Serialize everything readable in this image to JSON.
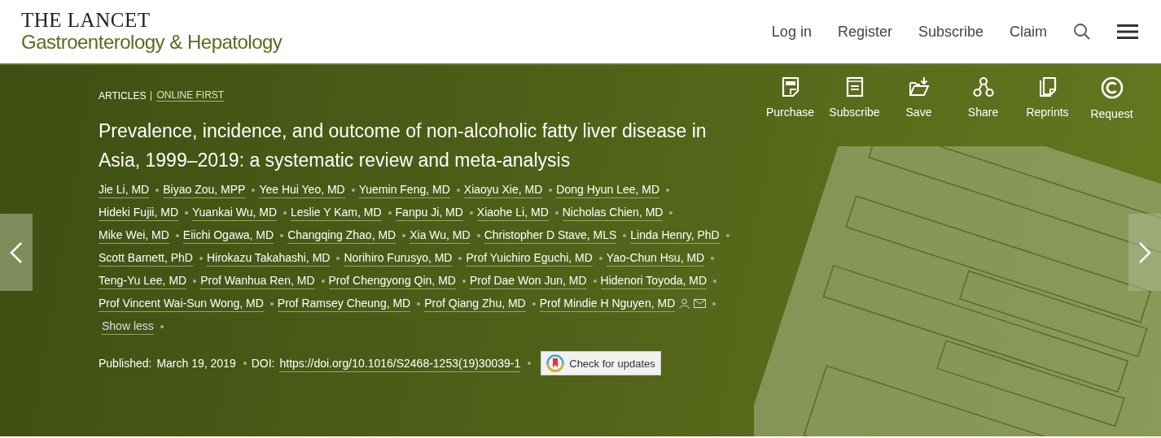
{
  "header": {
    "logo_top": "THE LANCET",
    "logo_bottom": "Gastroenterology & Hepatology",
    "nav": [
      "Log in",
      "Register",
      "Subscribe",
      "Claim"
    ]
  },
  "article": {
    "categories": [
      {
        "label": "ARTICLES",
        "link": false
      },
      {
        "label": "ONLINE FIRST",
        "link": true
      }
    ],
    "title": "Prevalence, incidence, and outcome of non-alcoholic fatty liver disease in Asia, 1999–2019: a systematic review and meta-analysis",
    "authors": [
      "Jie Li, MD",
      "Biyao Zou, MPP",
      "Yee Hui Yeo, MD",
      "Yuemin Feng, MD",
      "Xiaoyu Xie, MD",
      "Dong Hyun Lee, MD",
      "Hideki Fujii, MD",
      "Yuankai Wu, MD",
      "Leslie Y Kam, MD",
      "Fanpu Ji, MD",
      "Xiaohe Li, MD",
      "Nicholas Chien, MD",
      "Mike Wei, MD",
      "Eiichi Ogawa, MD",
      "Changqing Zhao, MD",
      "Xia Wu, MD",
      "Christopher D Stave, MLS",
      "Linda Henry, PhD",
      "Scott Barnett, PhD",
      "Hirokazu Takahashi, MD",
      "Norihiro Furusyo, MD",
      "Prof Yuichiro Eguchi, MD",
      "Yao-Chun Hsu, MD",
      "Teng-Yu Lee, MD",
      "Prof Wanhua Ren, MD",
      "Prof Chengyong Qin, MD",
      "Prof Dae Won Jun, MD",
      "Hidenori Toyoda, MD",
      "Prof Vincent Wai-Sun Wong, MD",
      "Prof Ramsey Cheung, MD",
      "Prof Qiang Zhu, MD",
      "Prof Mindie H Nguyen, MD"
    ],
    "show_less": "Show less",
    "published_label": "Published:",
    "published_date": "March 19, 2019",
    "doi_label": "DOI:",
    "doi": "https://doi.org/10.1016/S2468-1253(19)30039-1",
    "check_updates": "Check for updates"
  },
  "actions": [
    {
      "kind": "pdf",
      "label": "Purchase"
    },
    {
      "kind": "subscribe",
      "label": "Subscribe"
    },
    {
      "kind": "save",
      "label": "Save"
    },
    {
      "kind": "share",
      "label": "Share"
    },
    {
      "kind": "reprints",
      "label": "Reprints"
    },
    {
      "kind": "request",
      "label": "Request"
    }
  ]
}
